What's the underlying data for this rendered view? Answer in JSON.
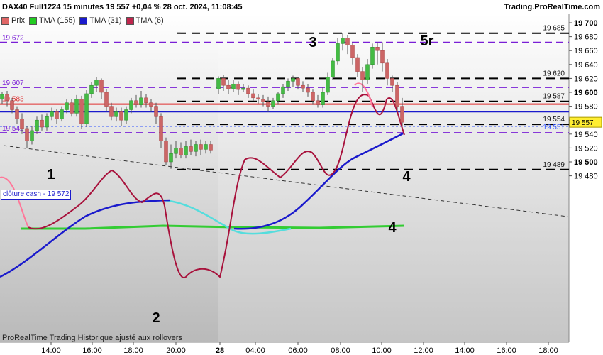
{
  "header": {
    "title": "DAX40 Full1224 15 minutes 19 557 +0,04 % 28 oct. 2024, 11:08:45",
    "source": "Trading.ProRealTime.com"
  },
  "legend": [
    {
      "label": "Prix",
      "color": "#e06666",
      "icon": "price-swatch"
    },
    {
      "label": "TMA (155)",
      "color": "#22cc22",
      "icon": "tma155-swatch"
    },
    {
      "label": "TMA (31)",
      "color": "#1a1acc",
      "icon": "tma31-swatch"
    },
    {
      "label": "TMA (6)",
      "color": "#c0264d",
      "icon": "tma6-swatch"
    }
  ],
  "cash_label": "clôture cash -  19 572",
  "footer": "ProRealTime Trading  Historique ajusté aux rollovers",
  "colors": {
    "up": "#44bb44",
    "down": "#cc6666",
    "red_line": "#e03030",
    "blue_line": "#1a1acc",
    "purple": "#7a1fd6",
    "tma155": "#33cc33",
    "tma31": "#1a1acc",
    "tma6": "#a8123c",
    "tma6_pink": "#ff7799",
    "cyan": "#55dddd"
  },
  "chart_data": {
    "type": "candlestick",
    "yaxis_ticks": [
      "19 700",
      "19 680",
      "19 660",
      "19 640",
      "19 620",
      "19 600",
      "19 580",
      "19 560",
      "19 540",
      "19 520",
      "19 500",
      "19 480"
    ],
    "ylim": [
      19475,
      19705
    ],
    "xaxis_ticks": [
      "14:00",
      "16:00",
      "18:00",
      "20:00",
      "28",
      "04:00",
      "06:00",
      "08:00",
      "10:00",
      "12:00",
      "14:00",
      "16:00",
      "18:00"
    ],
    "levels": [
      {
        "label": "19 685",
        "value": 19685,
        "style": "black-dashed",
        "side": "right"
      },
      {
        "label": "19 672",
        "value": 19672,
        "style": "purple-dashed",
        "side": "left"
      },
      {
        "label": "19 620",
        "value": 19620,
        "style": "black-dashed",
        "side": "right"
      },
      {
        "label": "19 607",
        "value": 19607,
        "style": "purple-dashed",
        "side": "left"
      },
      {
        "label": "19 587",
        "value": 19587,
        "style": "black-dashed",
        "side": "right"
      },
      {
        "label": "19 583",
        "value": 19583,
        "style": "red-solid",
        "side": "left"
      },
      {
        "label": "19 572",
        "value": 19572,
        "style": "blue-solid",
        "side": "none"
      },
      {
        "label": "19 554",
        "value": 19554,
        "style": "black-dashed",
        "side": "right"
      },
      {
        "label": "19 551",
        "value": 19551,
        "style": "blue-dashed",
        "side": "right"
      },
      {
        "label": "19 542",
        "value": 19542,
        "style": "purple-dashed",
        "side": "left"
      },
      {
        "label": "19 489",
        "value": 19489,
        "style": "black-dashed",
        "side": "right"
      }
    ],
    "last_price": "19 557",
    "annotations": [
      "1",
      "2",
      "3",
      "4",
      "4",
      "5r"
    ]
  }
}
